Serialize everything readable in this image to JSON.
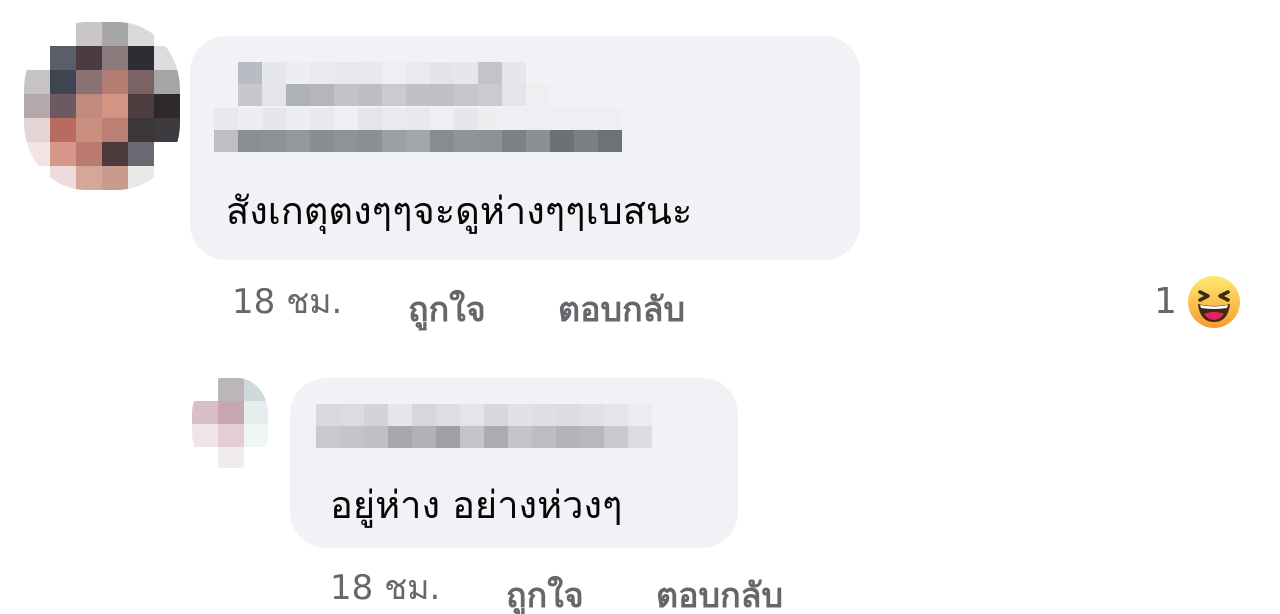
{
  "comments": [
    {
      "text": "สังเกตุตงๆๆจะดูห่างๆๆเบสนะ",
      "time": "18 ชม.",
      "like_label": "ถูกใจ",
      "reply_label": "ตอบกลับ",
      "reaction_count": "1",
      "reaction_icon": "haha-emoji-icon"
    },
    {
      "text": "อยู่ห่าง อย่างห่วงๆ",
      "time": "18 ชม.",
      "like_label": "ถูกใจ",
      "reply_label": "ตอบกลับ"
    }
  ],
  "colors": {
    "bubble": "#f0f2f5",
    "text": "#050505",
    "meta": "#65676b",
    "haha_face": "#f7b125",
    "haha_mouth": "#e0245e"
  }
}
